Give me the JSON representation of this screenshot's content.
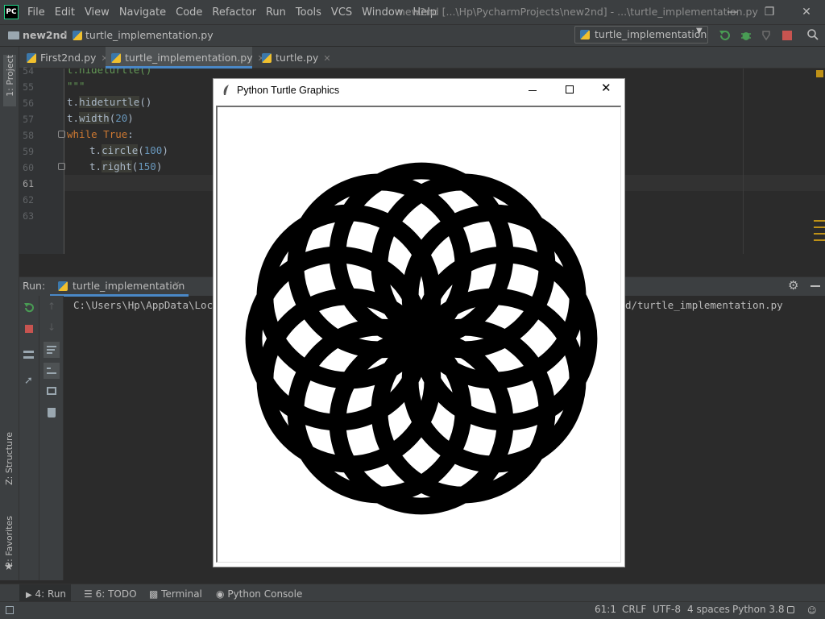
{
  "menubar": {
    "logo": "PC",
    "items": [
      "File",
      "Edit",
      "View",
      "Navigate",
      "Code",
      "Refactor",
      "Run",
      "Tools",
      "VCS",
      "Window",
      "Help"
    ],
    "window_title": "new2nd [...\\Hp\\PycharmProjects\\new2nd] - ...\\turtle_implementation.py"
  },
  "navbar": {
    "project": "new2nd",
    "file": "turtle_implementation.py",
    "run_config": "turtle_implementation"
  },
  "tabs": [
    {
      "label": "First2nd.py"
    },
    {
      "label": "turtle_implementation.py"
    },
    {
      "label": "turtle.py"
    }
  ],
  "left_strip": {
    "project": "1: Project",
    "structure": "Z: Structure",
    "favorites": "2: Favorites"
  },
  "editor": {
    "lines": [
      "54",
      "55",
      "56",
      "57",
      "58",
      "59",
      "60",
      "61",
      "62",
      "63"
    ],
    "code": {
      "l54": "t.hideturtle()",
      "l55": "\"\"\"",
      "l56_obj": "t.",
      "l56_fn": "hideturtle",
      "l56_rest": "()",
      "l57_obj": "t.",
      "l57_fn": "width",
      "l57_open": "(",
      "l57_num": "20",
      "l57_close": ")",
      "l58_kw1": "while",
      "l58_kw2": "True",
      "l58_colon": ":",
      "l59_obj": "t.",
      "l59_fn": "circle",
      "l59_open": "(",
      "l59_num": "100",
      "l59_close": ")",
      "l60_obj": "t.",
      "l60_fn": "right",
      "l60_open": "(",
      "l60_num": "150",
      "l60_close": ")"
    }
  },
  "run_panel": {
    "label": "Run:",
    "tab": "turtle_implementation",
    "console_start": "C:\\Users\\Hp\\AppData\\Local",
    "console_end": "d/turtle_implementation.py"
  },
  "turtle_window": {
    "title": "Python Turtle Graphics",
    "pattern": {
      "circles": 12,
      "radius": 100,
      "turn_degrees": 150,
      "pen_width": 20
    }
  },
  "bottom_tools": {
    "run": "4: Run",
    "todo": "6: TODO",
    "terminal": "Terminal",
    "python_console": "Python Console"
  },
  "status": {
    "position": "61:1",
    "line_sep": "CRLF",
    "encoding": "UTF-8",
    "indent": "4 spaces",
    "interpreter": "Python 3.8"
  },
  "colors": {
    "accent": "#4a88c7",
    "run_green": "#499c54",
    "stop_red": "#c75450",
    "keyword": "#cc7832",
    "number": "#6897bb"
  }
}
